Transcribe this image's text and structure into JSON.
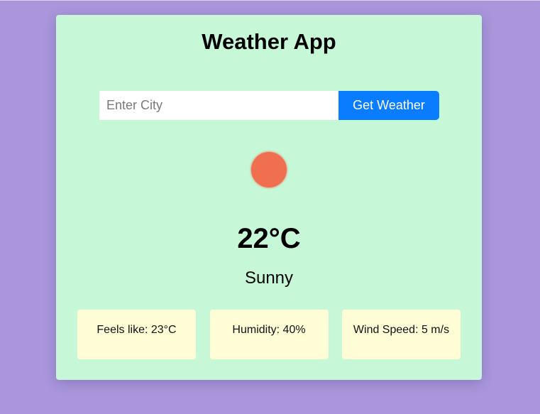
{
  "app": {
    "title": "Weather App"
  },
  "search": {
    "placeholder": "Enter City",
    "value": "",
    "button_label": "Get Weather"
  },
  "weather": {
    "icon": "sun-icon",
    "temperature": "22°C",
    "condition": "Sunny"
  },
  "details": {
    "feels_like": "Feels like: 23°C",
    "humidity": "Humidity: 40%",
    "wind_speed": "Wind Speed: 5 m/s"
  },
  "colors": {
    "background": "#a996db",
    "card": "#c6f7d6",
    "button": "#0a7cff",
    "sun": "#ef6f50",
    "detail_box": "#fffdd6"
  }
}
